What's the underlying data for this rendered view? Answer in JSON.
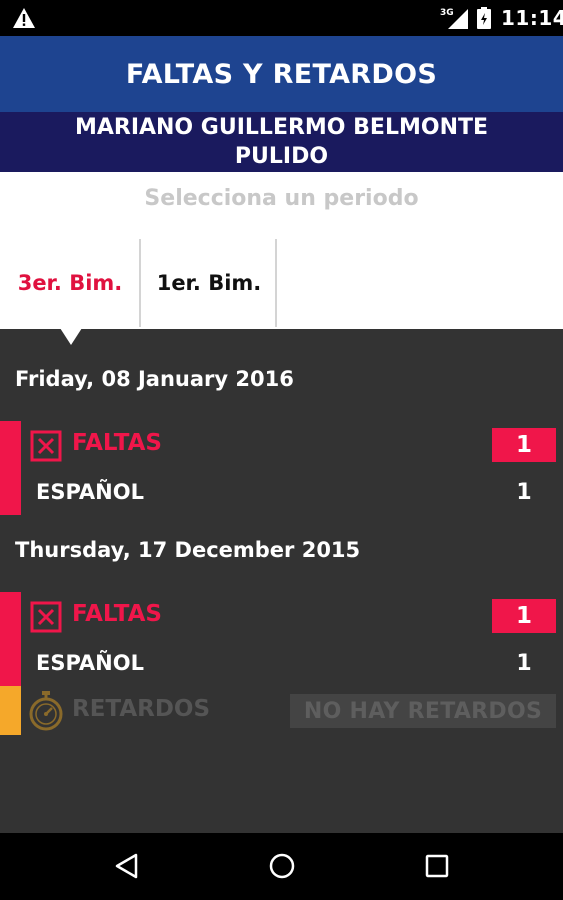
{
  "status_bar": {
    "warning_icon": "warning-icon",
    "network_type": "3G",
    "signal_icon": "signal-icon",
    "battery_icon": "battery-icon",
    "time": "11:14"
  },
  "header": {
    "title": "FALTAS Y RETARDOS"
  },
  "student": {
    "name_line1": "MARIANO GUILLERMO BELMONTE",
    "name_line2": "PULIDO"
  },
  "period_selector": {
    "prompt": "Selecciona un periodo",
    "tabs": [
      {
        "label": "3er. Bim.",
        "selected": true
      },
      {
        "label": "1er. Bim.",
        "selected": false
      }
    ]
  },
  "days": [
    {
      "date": "Friday, 08 January 2016",
      "faltas": {
        "label": "FALTAS",
        "count": "1",
        "subjects": [
          {
            "name": "ESPAÑOL",
            "count": "1"
          }
        ]
      }
    },
    {
      "date": "Thursday, 17 December 2015",
      "faltas": {
        "label": "FALTAS",
        "count": "1",
        "subjects": [
          {
            "name": "ESPAÑOL",
            "count": "1"
          }
        ]
      },
      "retardos": {
        "label": "RETARDOS",
        "status": "NO HAY RETARDOS"
      }
    }
  ],
  "colors": {
    "header_bg": "#1e4490",
    "student_bg": "#1a1a5e",
    "accent_red": "#f0164a",
    "accent_orange": "#f5a82a",
    "content_bg": "#333333"
  },
  "nav_bar": {
    "back_icon": "back-icon",
    "home_icon": "home-icon",
    "recents_icon": "recents-icon"
  }
}
